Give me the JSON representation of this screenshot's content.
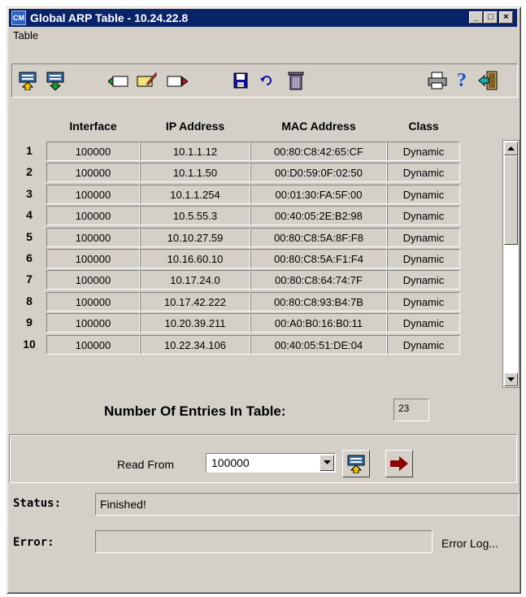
{
  "window": {
    "title": "Global ARP Table - 10.24.22.8",
    "app_icon_text": "CM"
  },
  "menu": {
    "items": [
      "Table"
    ]
  },
  "toolbar": {
    "icons": [
      "upload-icon",
      "download-icon",
      "insert-row-icon",
      "edit-row-icon",
      "delete-row-icon",
      "save-icon",
      "undo-icon",
      "trash-icon",
      "print-icon",
      "help-icon",
      "exit-icon"
    ]
  },
  "table": {
    "columns": [
      "Interface",
      "IP Address",
      "MAC Address",
      "Class"
    ],
    "rows": [
      {
        "num": "1",
        "interface": "100000",
        "ip": "10.1.1.12",
        "mac": "00:80:C8:42:65:CF",
        "cls": "Dynamic"
      },
      {
        "num": "2",
        "interface": "100000",
        "ip": "10.1.1.50",
        "mac": "00:D0:59:0F:02:50",
        "cls": "Dynamic"
      },
      {
        "num": "3",
        "interface": "100000",
        "ip": "10.1.1.254",
        "mac": "00:01:30:FA:5F:00",
        "cls": "Dynamic"
      },
      {
        "num": "4",
        "interface": "100000",
        "ip": "10.5.55.3",
        "mac": "00:40:05:2E:B2:98",
        "cls": "Dynamic"
      },
      {
        "num": "5",
        "interface": "100000",
        "ip": "10.10.27.59",
        "mac": "00:80:C8:5A:8F:F8",
        "cls": "Dynamic"
      },
      {
        "num": "6",
        "interface": "100000",
        "ip": "10.16.60.10",
        "mac": "00:80:C8:5A:F1:F4",
        "cls": "Dynamic"
      },
      {
        "num": "7",
        "interface": "100000",
        "ip": "10.17.24.0",
        "mac": "00:80:C8:64:74:7F",
        "cls": "Dynamic"
      },
      {
        "num": "8",
        "interface": "100000",
        "ip": "10.17.42.222",
        "mac": "00:80:C8:93:B4:7B",
        "cls": "Dynamic"
      },
      {
        "num": "9",
        "interface": "100000",
        "ip": "10.20.39.211",
        "mac": "00:A0:B0:16:B0:11",
        "cls": "Dynamic"
      },
      {
        "num": "10",
        "interface": "100000",
        "ip": "10.22.34.106",
        "mac": "00:40:05:51:DE:04",
        "cls": "Dynamic"
      }
    ]
  },
  "entries": {
    "label": "Number Of Entries In Table:",
    "value": "23"
  },
  "read_from": {
    "label": "Read From",
    "value": "100000"
  },
  "status": {
    "label": "Status:",
    "value": "Finished!"
  },
  "error": {
    "label": "Error:",
    "value": "",
    "log_link": "Error Log..."
  }
}
